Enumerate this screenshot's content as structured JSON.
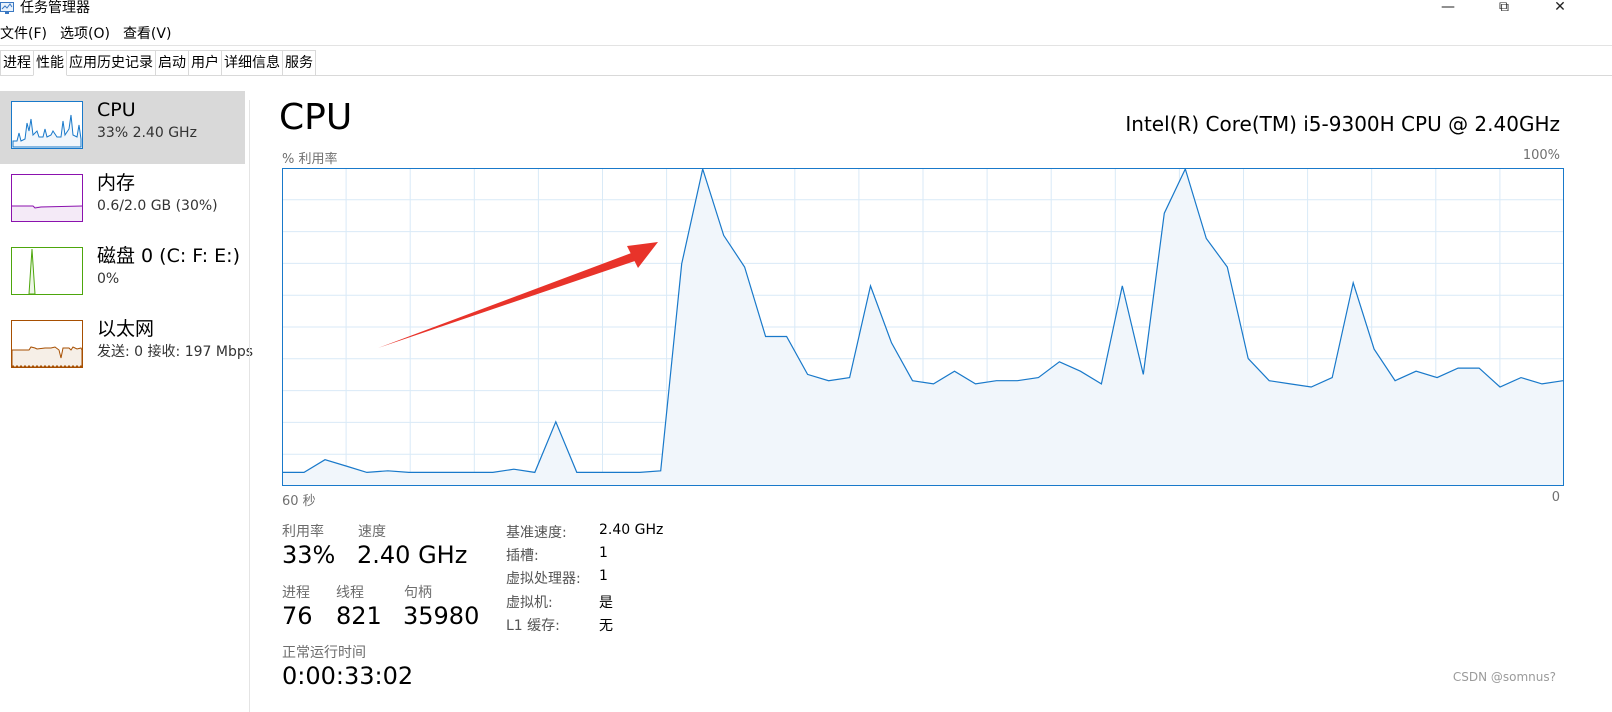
{
  "window": {
    "title": "任务管理器",
    "minimize_glyph": "—",
    "restore_glyph": "⧉",
    "close_glyph": "✕"
  },
  "menu": [
    "文件(F)",
    "选项(O)",
    "查看(V)"
  ],
  "tabs": [
    {
      "label": "进程",
      "active": false
    },
    {
      "label": "性能",
      "active": true
    },
    {
      "label": "应用历史记录",
      "active": false
    },
    {
      "label": "启动",
      "active": false
    },
    {
      "label": "用户",
      "active": false
    },
    {
      "label": "详细信息",
      "active": false
    },
    {
      "label": "服务",
      "active": false
    }
  ],
  "sidebar": [
    {
      "name": "CPU",
      "sub": "33% 2.40 GHz",
      "color": "#1979ca",
      "selected": true,
      "icon": "cpu-graph-icon"
    },
    {
      "name": "内存",
      "sub": "0.6/2.0 GB (30%)",
      "color": "#8b12ae",
      "selected": false,
      "icon": "memory-graph-icon"
    },
    {
      "name": "磁盘 0 (C: F: E:)",
      "sub": "0%",
      "color": "#4da60c",
      "selected": false,
      "icon": "disk-graph-icon"
    },
    {
      "name": "以太网",
      "sub": "发送: 0 接收: 197 Mbps",
      "color": "#a74f01",
      "selected": false,
      "icon": "ethernet-graph-icon"
    }
  ],
  "main": {
    "title": "CPU",
    "model": "Intel(R) Core(TM) i5-9300H CPU @ 2.40GHz",
    "graph_label": "% 利用率",
    "graph_max": "100%",
    "time_left": "60 秒",
    "time_right": "0"
  },
  "stats": {
    "utilization_label": "利用率",
    "utilization": "33%",
    "speed_label": "速度",
    "speed": "2.40 GHz",
    "processes_label": "进程",
    "processes": "76",
    "threads_label": "线程",
    "threads": "821",
    "handles_label": "句柄",
    "handles": "35980",
    "uptime_label": "正常运行时间",
    "uptime": "0:00:33:02"
  },
  "details": [
    {
      "label": "基准速度:",
      "value": "2.40 GHz"
    },
    {
      "label": "插槽:",
      "value": "1"
    },
    {
      "label": "虚拟处理器:",
      "value": "1"
    },
    {
      "label": "虚拟机:",
      "value": "是"
    },
    {
      "label": "L1 缓存:",
      "value": "无"
    }
  ],
  "chart_data": {
    "type": "area",
    "ylabel": "% 利用率",
    "ylim": [
      0,
      100
    ],
    "xlim": [
      60,
      0
    ],
    "grid": true,
    "line_color": "#1979ca",
    "fill_color": "#f1f6fb",
    "values": [
      4,
      4,
      8,
      6,
      4,
      4.5,
      4,
      4,
      4,
      4,
      4,
      5,
      4,
      20,
      4,
      4,
      4,
      4,
      4.5,
      70,
      100,
      79,
      69,
      47,
      47,
      35,
      33,
      34,
      63,
      45,
      33,
      32,
      36,
      32,
      33,
      33,
      34,
      39,
      36,
      32,
      63,
      35,
      86,
      100,
      78,
      69,
      40,
      33,
      32,
      31,
      34,
      64,
      43,
      33,
      36,
      34,
      37,
      37,
      31,
      34,
      32,
      33
    ]
  },
  "annotation": {
    "arrow_color": "#e8332a"
  },
  "watermark": "CSDN @somnus?"
}
